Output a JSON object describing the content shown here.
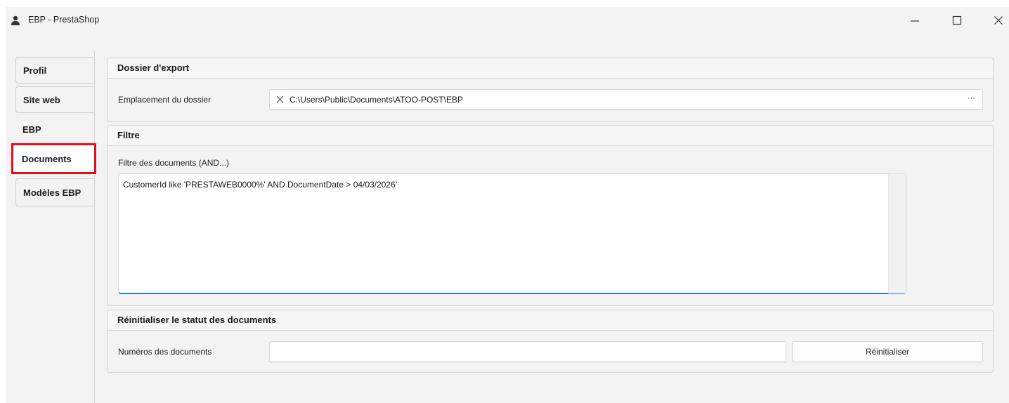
{
  "window": {
    "title": "EBP - PrestaShop"
  },
  "tabs": [
    {
      "label": "Profil"
    },
    {
      "label": "Site web"
    },
    {
      "label": "EBP"
    },
    {
      "label": "Documents",
      "selected": true
    },
    {
      "label": "Modèles EBP"
    }
  ],
  "export_folder": {
    "header": "Dossier d'export",
    "label": "Emplacement du dossier",
    "value": "C:\\Users\\Public\\Documents\\ATOO-POST\\EBP",
    "browse_label": "···"
  },
  "filter": {
    "header": "Filtre",
    "label": "Filtre des documents (AND...)",
    "value": "CustomerId like 'PRESTAWEB0000%' AND DocumentDate > 04/03/2026'"
  },
  "reset": {
    "header": "Réinitialiser le statut des documents",
    "label": "Numéros des documents",
    "value": "",
    "button_label": "Réinitialiser"
  },
  "colors": {
    "highlight": "#e0101a",
    "focus_underline": "#2b7fd4"
  },
  "icons": [
    "user-icon",
    "minimize-icon",
    "maximize-icon",
    "close-icon",
    "clear-icon"
  ]
}
